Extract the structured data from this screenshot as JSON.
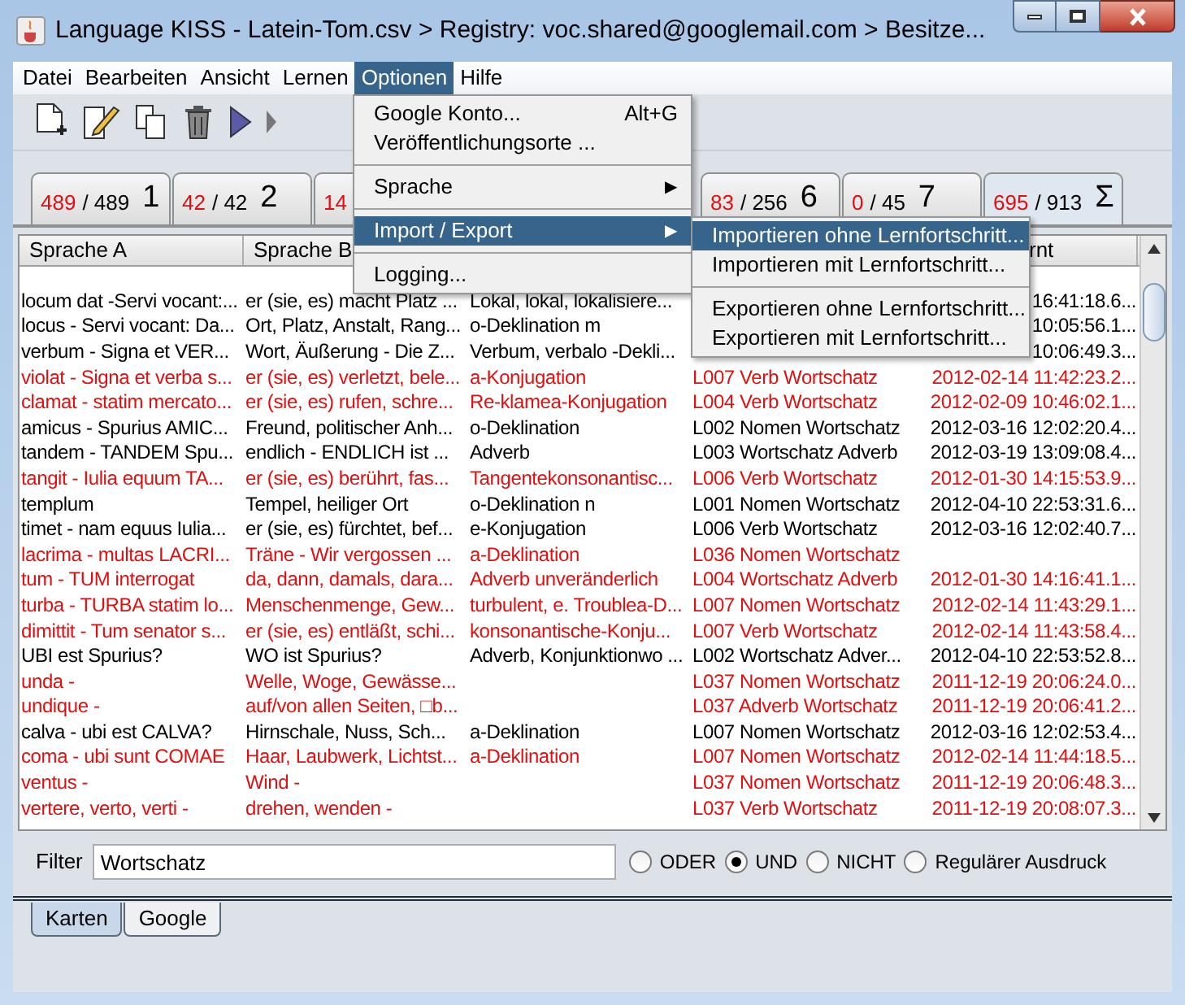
{
  "window": {
    "title": "Language KISS - Latein-Tom.csv > Registry: voc.shared@googlemail.com > Besitze..."
  },
  "menu_bar": [
    {
      "label": "Datei",
      "selected": false
    },
    {
      "label": "Bearbeiten",
      "selected": false
    },
    {
      "label": "Ansicht",
      "selected": false
    },
    {
      "label": "Lernen",
      "selected": false
    },
    {
      "label": "Optionen",
      "selected": true
    },
    {
      "label": "Hilfe",
      "selected": false
    }
  ],
  "open_menu": {
    "items": [
      {
        "kind": "item",
        "label": "Google Konto...",
        "shortcut": "Alt+G",
        "selected": false
      },
      {
        "kind": "item",
        "label": "Veröffentlichungsorte ...",
        "selected": false
      },
      {
        "kind": "separator"
      },
      {
        "kind": "submenu",
        "label": "Sprache",
        "arrow": "▶",
        "selected": false
      },
      {
        "kind": "separator"
      },
      {
        "kind": "submenu",
        "label": "Import / Export",
        "arrow": "▶",
        "selected": true
      },
      {
        "kind": "separator"
      },
      {
        "kind": "item",
        "label": "Logging...",
        "selected": false
      }
    ],
    "submenu": [
      {
        "kind": "item",
        "label": "Importieren ohne Lernfortschritt...",
        "selected": true
      },
      {
        "kind": "item",
        "label": "Importieren mit Lernfortschritt...",
        "selected": false
      },
      {
        "kind": "separator"
      },
      {
        "kind": "item",
        "label": "Exportieren ohne Lernfortschritt...",
        "selected": false
      },
      {
        "kind": "item",
        "label": "Exportieren mit Lernfortschritt...",
        "selected": false
      }
    ]
  },
  "toolbar": [
    {
      "kind": "new"
    },
    {
      "kind": "edit"
    },
    {
      "kind": "copy"
    },
    {
      "kind": "delete"
    },
    {
      "kind": "play"
    },
    {
      "kind": "partial"
    }
  ],
  "box_tabs": [
    {
      "due": "489",
      "total": "/ 489",
      "number": "1",
      "selected": false
    },
    {
      "due": "42",
      "total": "/ 42",
      "number": "2",
      "selected": false
    },
    {
      "due": "14",
      "selected": false
    },
    {
      "kind": "hidden"
    },
    {
      "due": "83",
      "total": "/ 256",
      "number": "6",
      "selected": false
    },
    {
      "due": "0",
      "total": "/ 45",
      "number": "7",
      "selected": false
    },
    {
      "due": "695",
      "total": "/ 913",
      "number": "Σ",
      "selected": true
    }
  ],
  "table": {
    "header": {
      "sprache_a": "Sprache A",
      "sprache_b": "Sprache B",
      "column_5": "rnt"
    },
    "rows": [
      {
        "highlighted": false,
        "sprache_a": "locum dat -Servi vocant:...",
        "sprache_b": "er (sie, es) macht Platz ...",
        "column_3": "Lokal, lokal, lokalisiere...",
        "column_5": "16:41:18.6..."
      },
      {
        "highlighted": false,
        "sprache_a": "locus - Servi vocant: Da...",
        "sprache_b": "Ort, Platz, Anstalt, Rang...",
        "column_3": "o-Deklination m",
        "column_5": "10:05:56.1..."
      },
      {
        "highlighted": false,
        "sprache_a": "verbum - Signa et VER...",
        "sprache_b": "Wort, Äußerung - Die Z...",
        "column_3": "Verbum, verbalo -Dekli...",
        "column_5": "10:06:49.3..."
      },
      {
        "highlighted": true,
        "sprache_a": "violat - Signa et verba s...",
        "sprache_b": "er (sie, es) verletzt, bele...",
        "column_3": "a-Konjugation",
        "column_4": "L007 Verb Wortschatz",
        "column_5": "2012-02-14 11:42:23.2..."
      },
      {
        "highlighted": true,
        "sprache_a": "clamat - statim mercato...",
        "sprache_b": "er (sie, es) rufen, schre...",
        "column_3": "Re-klamea-Konjugation",
        "column_4": "L004 Verb Wortschatz",
        "column_5": "2012-02-09 10:46:02.1..."
      },
      {
        "highlighted": false,
        "sprache_a": "amicus - Spurius AMIC...",
        "sprache_b": "Freund, politischer Anh...",
        "column_3": "o-Deklination",
        "column_4": "L002 Nomen Wortschatz",
        "column_5": "2012-03-16 12:02:20.4..."
      },
      {
        "highlighted": false,
        "sprache_a": "tandem - TANDEM Spu...",
        "sprache_b": "endlich - ENDLICH ist ...",
        "column_3": "Adverb",
        "column_4": "L003 Wortschatz Adverb",
        "column_5": "2012-03-19 13:09:08.4..."
      },
      {
        "highlighted": true,
        "sprache_a": "tangit - Iulia equum TA...",
        "sprache_b": "er (sie, es) berührt, fas...",
        "column_3": "Tangentekonsonantisc...",
        "column_4": "L006 Verb Wortschatz",
        "column_5": "2012-01-30 14:15:53.9..."
      },
      {
        "highlighted": false,
        "sprache_a": "templum",
        "sprache_b": "Tempel, heiliger Ort",
        "column_3": "o-Deklination n",
        "column_4": "L001 Nomen Wortschatz",
        "column_5": "2012-04-10 22:53:31.6..."
      },
      {
        "highlighted": false,
        "sprache_a": "timet - nam equus Iulia...",
        "sprache_b": "er (sie, es) fürchtet, bef...",
        "column_3": "e-Konjugation",
        "column_4": "L006 Verb Wortschatz",
        "column_5": "2012-03-16 12:02:40.7..."
      },
      {
        "highlighted": true,
        "sprache_a": "lacrima - multas LACRI...",
        "sprache_b": "Träne - Wir vergossen ...",
        "column_3": "a-Deklination",
        "column_4": "L036 Nomen Wortschatz"
      },
      {
        "highlighted": true,
        "sprache_a": "tum - TUM interrogat",
        "sprache_b": "da, dann, damals, dara...",
        "column_3": "Adverb unveränderlich",
        "column_4": "L004 Wortschatz Adverb",
        "column_5": "2012-01-30 14:16:41.1..."
      },
      {
        "highlighted": true,
        "sprache_a": "turba - TURBA statim lo...",
        "sprache_b": "Menschenmenge, Gew...",
        "column_3": "turbulent, e. Troublea-D...",
        "column_4": "L007 Nomen Wortschatz",
        "column_5": "2012-02-14 11:43:29.1..."
      },
      {
        "highlighted": true,
        "sprache_a": "dimittit - Tum senator s...",
        "sprache_b": "er (sie, es) entläßt, schi...",
        "column_3": "konsonantische-Konju...",
        "column_4": "L007 Verb Wortschatz",
        "column_5": "2012-02-14 11:43:58.4..."
      },
      {
        "highlighted": false,
        "sprache_a": "UBI est Spurius?",
        "sprache_b": "WO ist Spurius?",
        "column_3": "Adverb, Konjunktionwo ...",
        "column_4": "L002 Wortschatz Adver...",
        "column_5": "2012-04-10 22:53:52.8..."
      },
      {
        "highlighted": true,
        "sprache_a": "unda -",
        "sprache_b": "Welle, Woge, Gewässe...",
        "column_4": "L037 Nomen Wortschatz",
        "column_5": "2011-12-19 20:06:24.0..."
      },
      {
        "highlighted": true,
        "sprache_a": "undique -",
        "sprache_b": "auf/von allen Seiten, □b...",
        "column_4": "L037 Adverb Wortschatz",
        "column_5": "2011-12-19 20:06:41.2..."
      },
      {
        "highlighted": false,
        "sprache_a": "calva - ubi est CALVA?",
        "sprache_b": "Hirnschale, Nuss, Sch...",
        "column_3": "a-Deklination",
        "column_4": "L007 Nomen Wortschatz",
        "column_5": "2012-03-16 12:02:53.4..."
      },
      {
        "highlighted": true,
        "sprache_a": "coma - ubi sunt COMAE",
        "sprache_b": "Haar, Laubwerk, Lichtst...",
        "column_3": "a-Deklination",
        "column_4": "L007 Nomen Wortschatz",
        "column_5": "2012-02-14 11:44:18.5..."
      },
      {
        "highlighted": true,
        "sprache_a": "ventus -",
        "sprache_b": "Wind -",
        "column_4": "L037 Nomen Wortschatz",
        "column_5": "2011-12-19 20:06:48.3..."
      },
      {
        "highlighted": true,
        "sprache_a": "vertere, verto, verti -",
        "sprache_b": "drehen, wenden -",
        "column_4": "L037 Verb Wortschatz",
        "column_5": "2011-12-19 20:08:07.3..."
      }
    ]
  },
  "filter": {
    "label": "Filter",
    "value": "Wortschatz",
    "options": [
      {
        "label": "ODER",
        "selected": false
      },
      {
        "label": "UND",
        "selected": true
      },
      {
        "label": "NICHT",
        "selected": false
      },
      {
        "label": "Regulärer Ausdruck",
        "selected": false
      }
    ]
  },
  "bottom_tabs": [
    {
      "label": "Karten",
      "selected": true
    },
    {
      "label": "Google",
      "selected": false
    }
  ]
}
